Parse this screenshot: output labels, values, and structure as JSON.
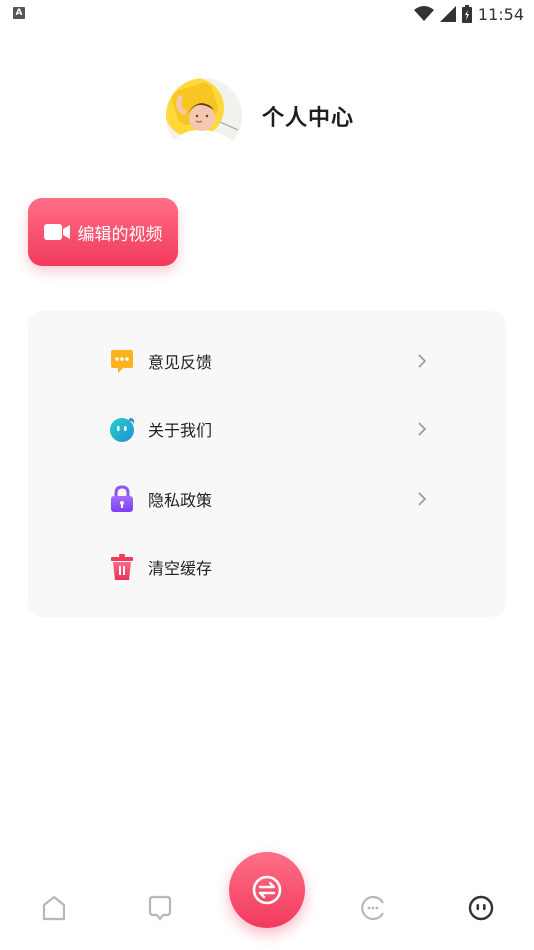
{
  "status_bar": {
    "notification_icon": "A",
    "time": "11:54",
    "icons": [
      "wifi-icon",
      "signal-icon",
      "battery-icon"
    ]
  },
  "header": {
    "title": "个人中心",
    "avatar": "avatar-illustration"
  },
  "edit_button": {
    "label": "编辑的视频",
    "icon": "video-camera-icon"
  },
  "menu": {
    "items": [
      {
        "label": "意见反馈",
        "icon": "feedback-icon",
        "has_chevron": true
      },
      {
        "label": "关于我们",
        "icon": "about-icon",
        "has_chevron": true
      },
      {
        "label": "隐私政策",
        "icon": "lock-icon",
        "has_chevron": true
      },
      {
        "label": "清空缓存",
        "icon": "trash-icon",
        "has_chevron": false
      }
    ]
  },
  "bottom_nav": {
    "items": [
      "home-icon",
      "chat-icon",
      "convert-icon",
      "emoji-icon",
      "profile-icon"
    ],
    "active": "profile-icon"
  },
  "colors": {
    "accent": "#f23a5d",
    "accent_light": "#ff6f86",
    "card_bg": "#f8f8f8"
  }
}
